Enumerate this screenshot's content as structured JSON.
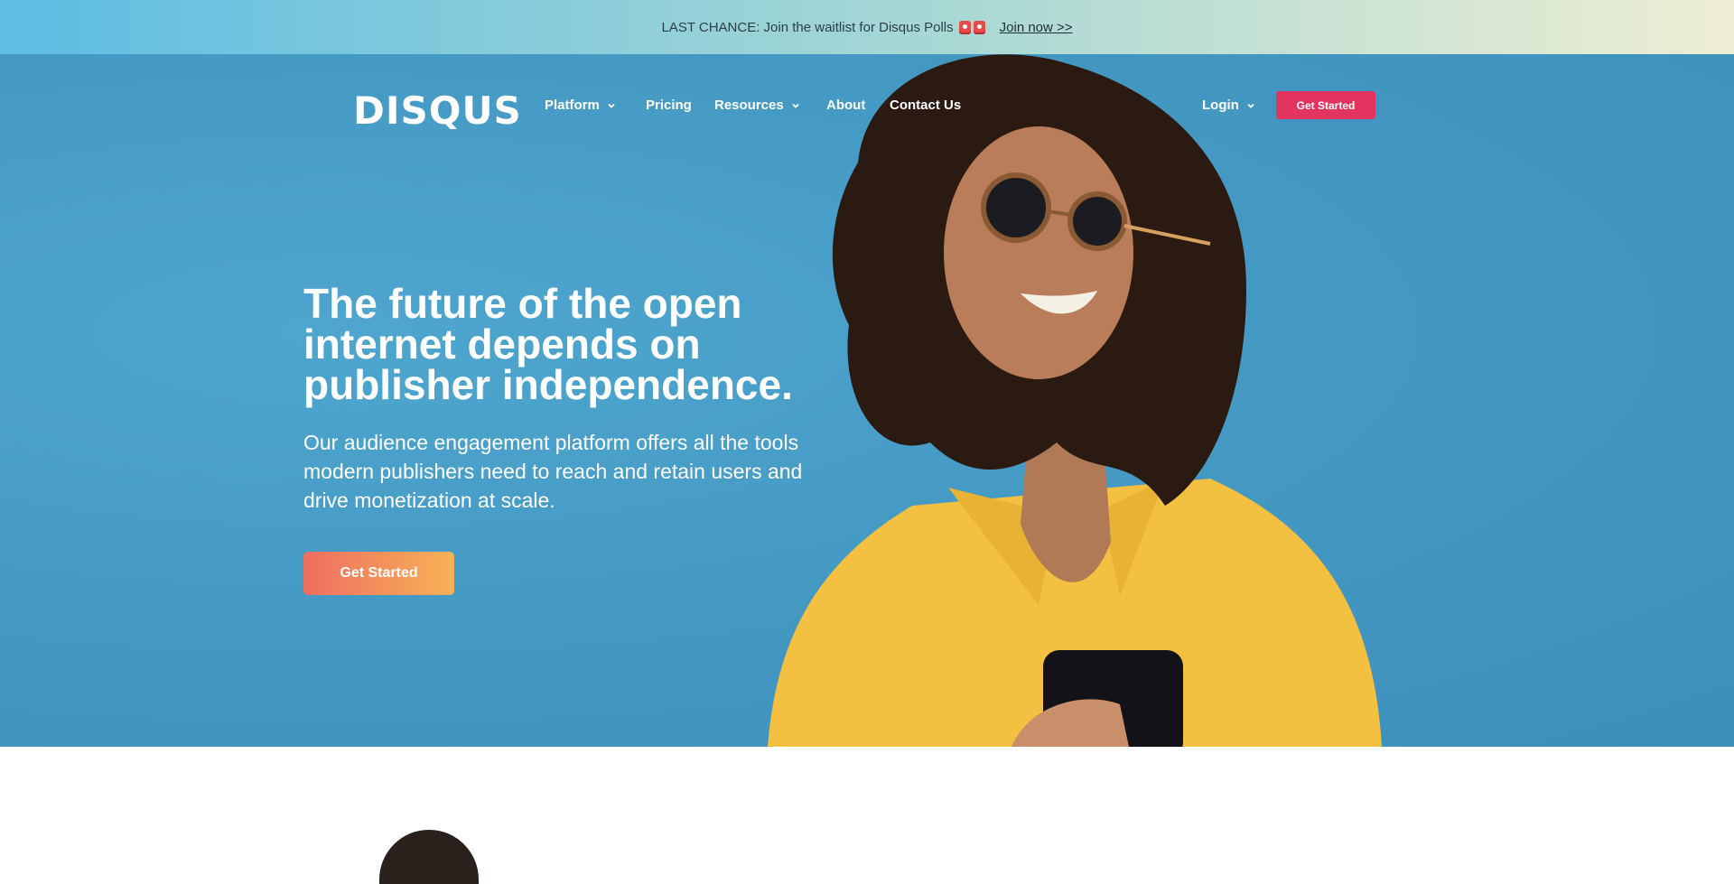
{
  "banner": {
    "message": "LAST CHANCE: Join the waitlist for Disqus Polls",
    "icons": [
      "dice-icon",
      "dice-icon"
    ],
    "link_label": "Join now >>"
  },
  "nav": {
    "logo": "DISQUS",
    "items": [
      {
        "label": "Platform",
        "has_dropdown": true
      },
      {
        "label": "Pricing",
        "has_dropdown": false
      },
      {
        "label": "Resources",
        "has_dropdown": true
      },
      {
        "label": "About",
        "has_dropdown": false
      },
      {
        "label": "Contact Us",
        "has_dropdown": false
      }
    ],
    "login_label": "Login",
    "cta_label": "Get Started"
  },
  "hero": {
    "title": "The future of the open internet depends on publisher independence.",
    "subtitle": "Our audience engagement platform offers all the tools modern publishers need to reach and retain users and drive monetization at scale.",
    "cta_label": "Get Started"
  },
  "colors": {
    "hero_background": "#4499c3",
    "nav_cta": "#e2345f",
    "hero_cta_start": "#f06e61",
    "hero_cta_end": "#f6b257"
  }
}
